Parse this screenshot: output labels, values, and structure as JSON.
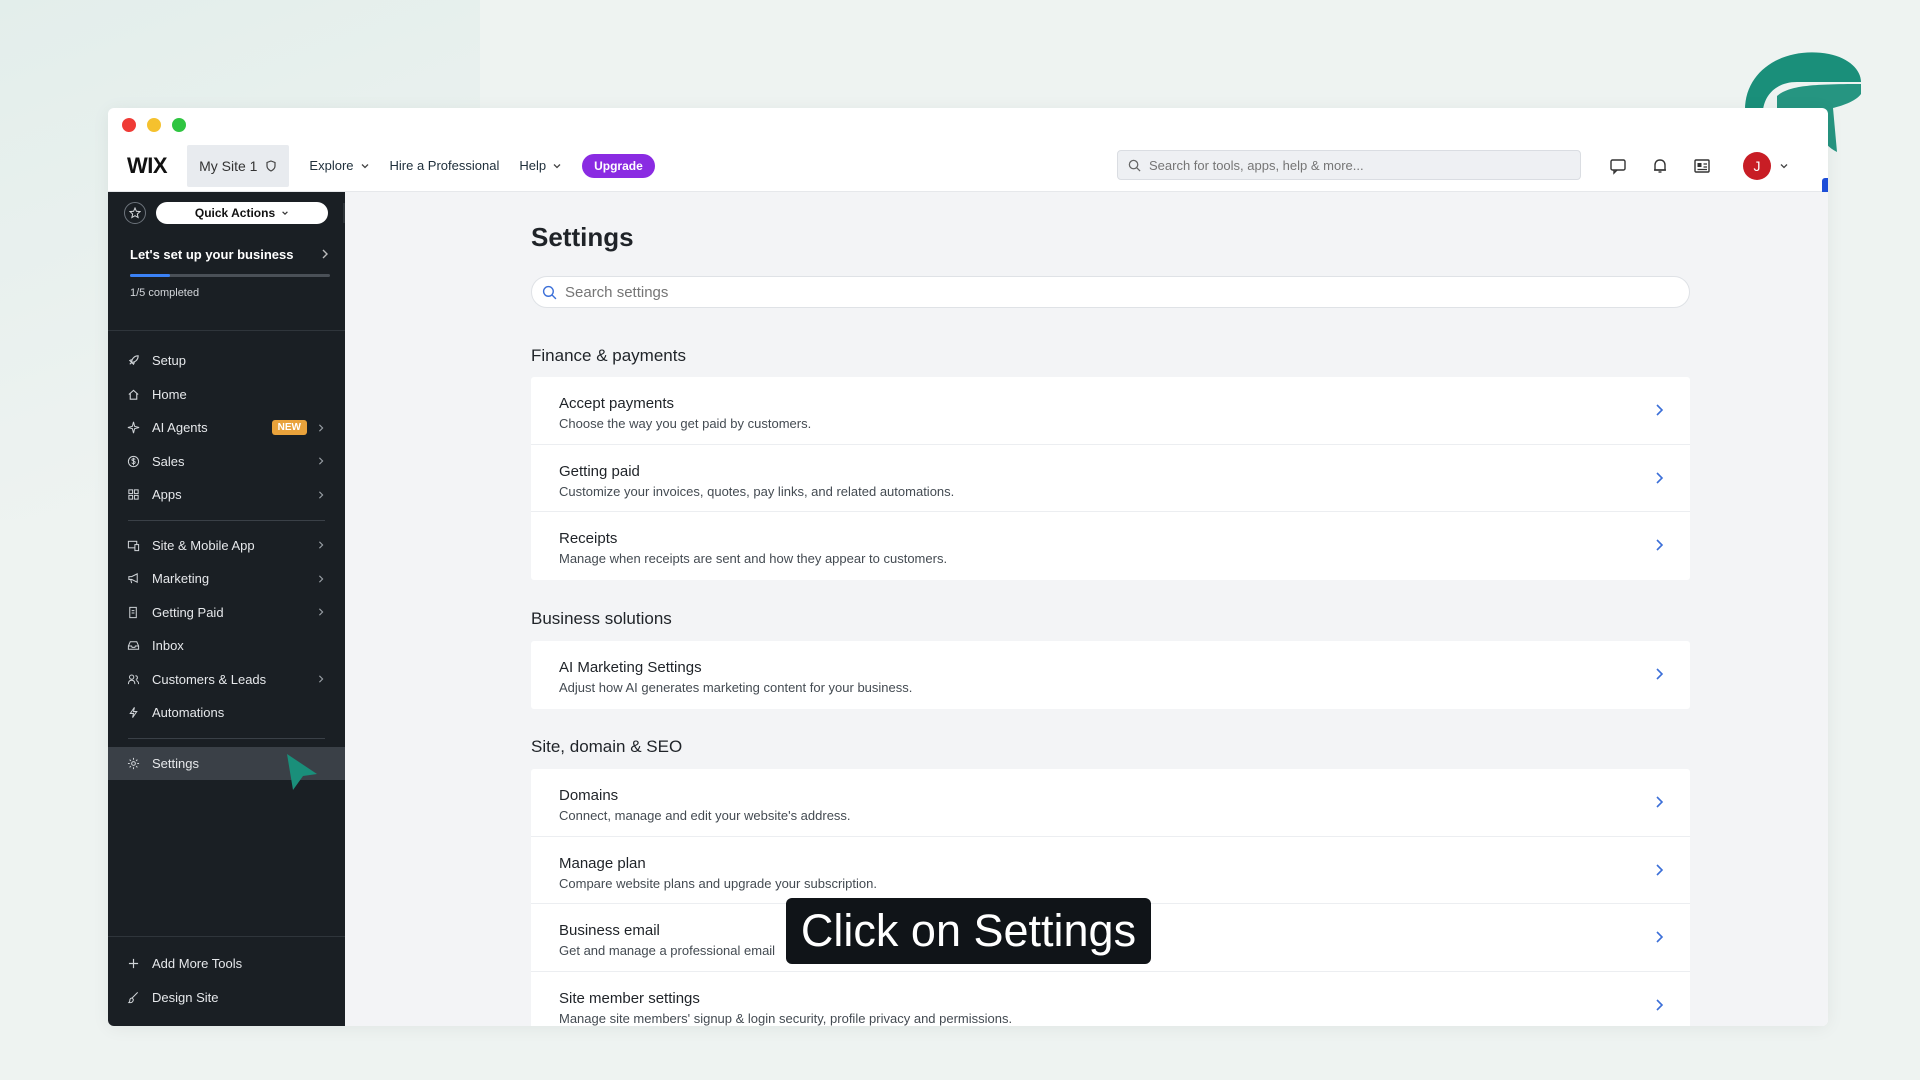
{
  "topnav": {
    "logo": "WIX",
    "site_name": "My Site 1",
    "explore_label": "Explore",
    "hire_label": "Hire a Professional",
    "help_label": "Help",
    "upgrade_label": "Upgrade",
    "search_placeholder": "Search for tools, apps, help & more...",
    "avatar_initial": "J"
  },
  "sidebar": {
    "quick_actions_label": "Quick Actions",
    "setup_card": {
      "title": "Let's set up your business",
      "progress": 0.2,
      "progress_text": "1/5 completed"
    },
    "items": [
      {
        "label": "Setup",
        "icon": "rocket-icon"
      },
      {
        "label": "Home",
        "icon": "home-icon"
      },
      {
        "label": "AI Agents",
        "icon": "sparkle-icon",
        "badge": "NEW"
      },
      {
        "label": "Sales",
        "icon": "dollar-icon"
      },
      {
        "label": "Apps",
        "icon": "apps-icon"
      },
      {
        "label": "Site & Mobile App",
        "icon": "devices-icon"
      },
      {
        "label": "Marketing",
        "icon": "megaphone-icon"
      },
      {
        "label": "Getting Paid",
        "icon": "invoice-icon"
      },
      {
        "label": "Inbox",
        "icon": "inbox-icon"
      },
      {
        "label": "Customers & Leads",
        "icon": "people-icon"
      },
      {
        "label": "Automations",
        "icon": "bolt-icon"
      },
      {
        "label": "Settings",
        "icon": "gear-icon",
        "active": true
      }
    ],
    "bottom_items": [
      {
        "label": "Add More Tools",
        "icon": "plus-icon"
      },
      {
        "label": "Design Site",
        "icon": "brush-icon"
      }
    ]
  },
  "main": {
    "title": "Settings",
    "search_placeholder": "Search settings",
    "sections": [
      {
        "title": "Finance & payments",
        "rows": [
          {
            "title": "Accept payments",
            "desc": "Choose the way you get paid by customers."
          },
          {
            "title": "Getting paid",
            "desc": "Customize your invoices, quotes, pay links, and related automations."
          },
          {
            "title": "Receipts",
            "desc": "Manage when receipts are sent and how they appear to customers."
          }
        ]
      },
      {
        "title": "Business solutions",
        "rows": [
          {
            "title": "AI Marketing Settings",
            "desc": "Adjust how AI generates marketing content for your business."
          }
        ]
      },
      {
        "title": "Site, domain & SEO",
        "rows": [
          {
            "title": "Domains",
            "desc": "Connect, manage and edit your website's address."
          },
          {
            "title": "Manage plan",
            "desc": "Compare website plans and upgrade your subscription."
          },
          {
            "title": "Business email",
            "desc": "Get and manage a professional email"
          },
          {
            "title": "Site member settings",
            "desc": "Manage site members' signup & login security, profile privacy and permissions."
          }
        ]
      }
    ]
  },
  "caption": "Click on Settings",
  "colors": {
    "accent_purple": "#8a2be2",
    "sidebar_bg": "#1a1f24",
    "badge_orange": "#e9a23b",
    "progress_blue": "#3b82f6",
    "brand_teal": "#1a8f7a",
    "avatar_red": "#c81d25"
  }
}
